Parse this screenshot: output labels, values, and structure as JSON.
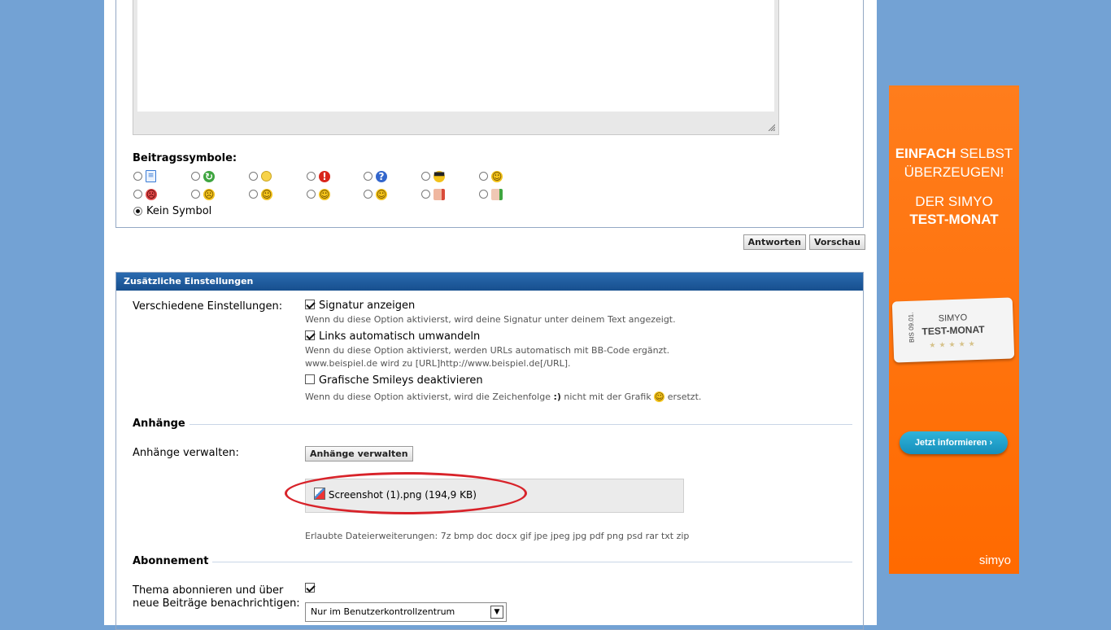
{
  "post_icons": {
    "label": "Beitragssymbole:",
    "none_label": "Kein Symbol",
    "icons": [
      {
        "name": "document-icon",
        "glyph": "▤",
        "color": "#3a7bd5"
      },
      {
        "name": "reload-arrow-icon",
        "glyph": "↻",
        "color": "#2f9a32"
      },
      {
        "name": "lightbulb-icon",
        "glyph": "●",
        "color": "#f3c232"
      },
      {
        "name": "exclamation-icon",
        "glyph": "!",
        "color": "#d9261c"
      },
      {
        "name": "question-icon",
        "glyph": "?",
        "color": "#3366cc"
      },
      {
        "name": "cool-smiley-icon",
        "glyph": "☺",
        "color": "#f2b90c"
      },
      {
        "name": "smile-icon",
        "glyph": "☺",
        "color": "#f2b90c"
      },
      {
        "name": "angry-smiley-icon",
        "glyph": "☹",
        "color": "#e04040"
      },
      {
        "name": "sad-smiley-icon",
        "glyph": "☹",
        "color": "#f2b90c"
      },
      {
        "name": "laughing-smiley-icon",
        "glyph": "☺",
        "color": "#f2b90c"
      },
      {
        "name": "wink-smiley-icon",
        "glyph": "☺",
        "color": "#f2b90c"
      },
      {
        "name": "grin-smiley-icon",
        "glyph": "☺",
        "color": "#f2b90c"
      },
      {
        "name": "thumbs-down-icon",
        "glyph": "✋",
        "color": "#e07f6a"
      },
      {
        "name": "thumbs-up-icon",
        "glyph": "✋",
        "color": "#e5a58a"
      }
    ]
  },
  "buttons": {
    "reply": "Antworten",
    "preview": "Vorschau"
  },
  "settings": {
    "title": "Zusätzliche Einstellungen",
    "misc_label": "Verschiedene Einstellungen:",
    "signature": {
      "label": "Signatur anzeigen",
      "checked": true,
      "hint": "Wenn du diese Option aktivierst, wird deine Signatur unter deinem Text angezeigt."
    },
    "links": {
      "label": "Links automatisch umwandeln",
      "checked": true,
      "hint1": "Wenn du diese Option aktivierst, werden URLs automatisch mit BB-Code ergänzt.",
      "hint2": "www.beispiel.de wird zu [URL]http://www.beispiel.de[/URL]."
    },
    "smileys": {
      "label": "Grafische Smileys deaktivieren",
      "checked": false,
      "hint_a": "Wenn du diese Option aktivierst, wird die Zeichenfolge",
      "hint_code": ":)",
      "hint_b": "nicht mit der Grafik",
      "hint_c": "ersetzt."
    }
  },
  "attachments": {
    "section_title": "Anhänge",
    "manage_label": "Anhänge verwalten:",
    "manage_button": "Anhänge verwalten",
    "file": "Screenshot (1).png (194,9 KB)",
    "allowed": "Erlaubte Dateierweiterungen: 7z bmp doc docx gif jpe jpeg jpg pdf png psd rar txt zip"
  },
  "subscription": {
    "section_title": "Abonnement",
    "label_line1": "Thema abonnieren und über",
    "label_line2": "neue Beiträge benachrichtigen:",
    "checked": true,
    "select_value": "Nur im Benutzerkontrollzentrum"
  },
  "ad": {
    "line1_bold": "EINFACH",
    "line1_rest": "SELBST",
    "line2": "ÜBERZEUGEN!",
    "line3": "DER SIMYO",
    "line4": "TEST-MONAT",
    "ticket_brand": "SIMYO",
    "ticket_title": "TEST-MONAT",
    "ticket_date": "BIS 09.01.",
    "cta": "Jetzt informieren",
    "logo": "simyo",
    "brand_color": "#ff6a00"
  }
}
